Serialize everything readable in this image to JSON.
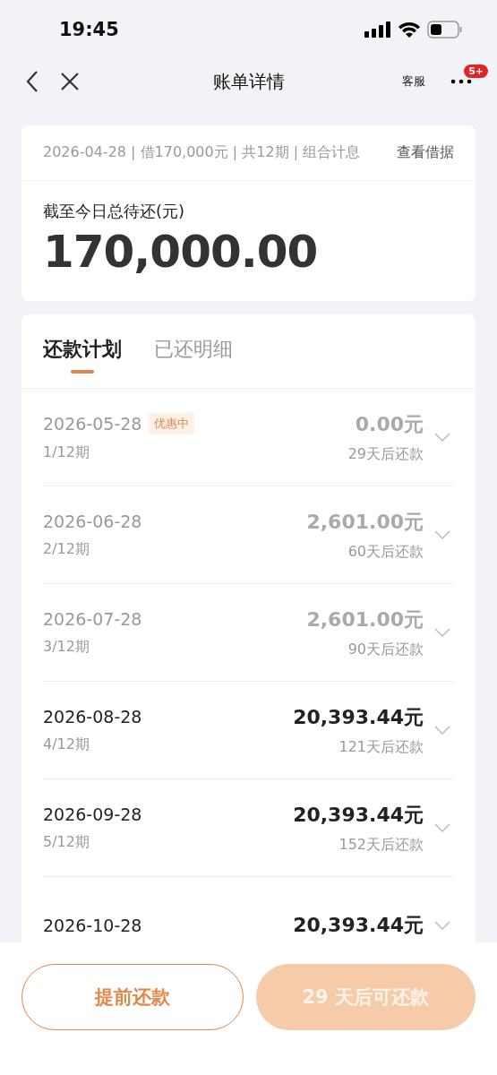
{
  "status_bar": {
    "time": "19:45"
  },
  "nav": {
    "title": "账单详情",
    "service_label": "客服",
    "more_badge": "5+"
  },
  "summary": {
    "meta": "2026-04-28 | 借170,000元 | 共12期 | 组合计息",
    "link": "查看借据",
    "label": "截至今日总待还(元)",
    "amount": "170,000.00"
  },
  "tabs": [
    {
      "label": "还款计划",
      "selected": true
    },
    {
      "label": "已还明细",
      "selected": false
    }
  ],
  "plan": [
    {
      "date": "2026-05-28",
      "tag": "优惠中",
      "period": "1/12期",
      "amount": "0.00元",
      "due": "29天后还款",
      "dimmed": true
    },
    {
      "date": "2026-06-28",
      "period": "2/12期",
      "amount": "2,601.00元",
      "due": "60天后还款",
      "dimmed": true
    },
    {
      "date": "2026-07-28",
      "period": "3/12期",
      "amount": "2,601.00元",
      "due": "90天后还款",
      "dimmed": true
    },
    {
      "date": "2026-08-28",
      "period": "4/12期",
      "amount": "20,393.44元",
      "due": "121天后还款",
      "dimmed": false
    },
    {
      "date": "2026-09-28",
      "period": "5/12期",
      "amount": "20,393.44元",
      "due": "152天后还款",
      "dimmed": false
    },
    {
      "date": "2026-10-28",
      "amount": "20,393.44元",
      "dimmed": false
    }
  ],
  "buttons": [
    {
      "label": "提前还款",
      "disabled": false,
      "kind": "outline"
    },
    {
      "label": "29 天后可还款",
      "disabled": true,
      "kind": "solid"
    }
  ]
}
